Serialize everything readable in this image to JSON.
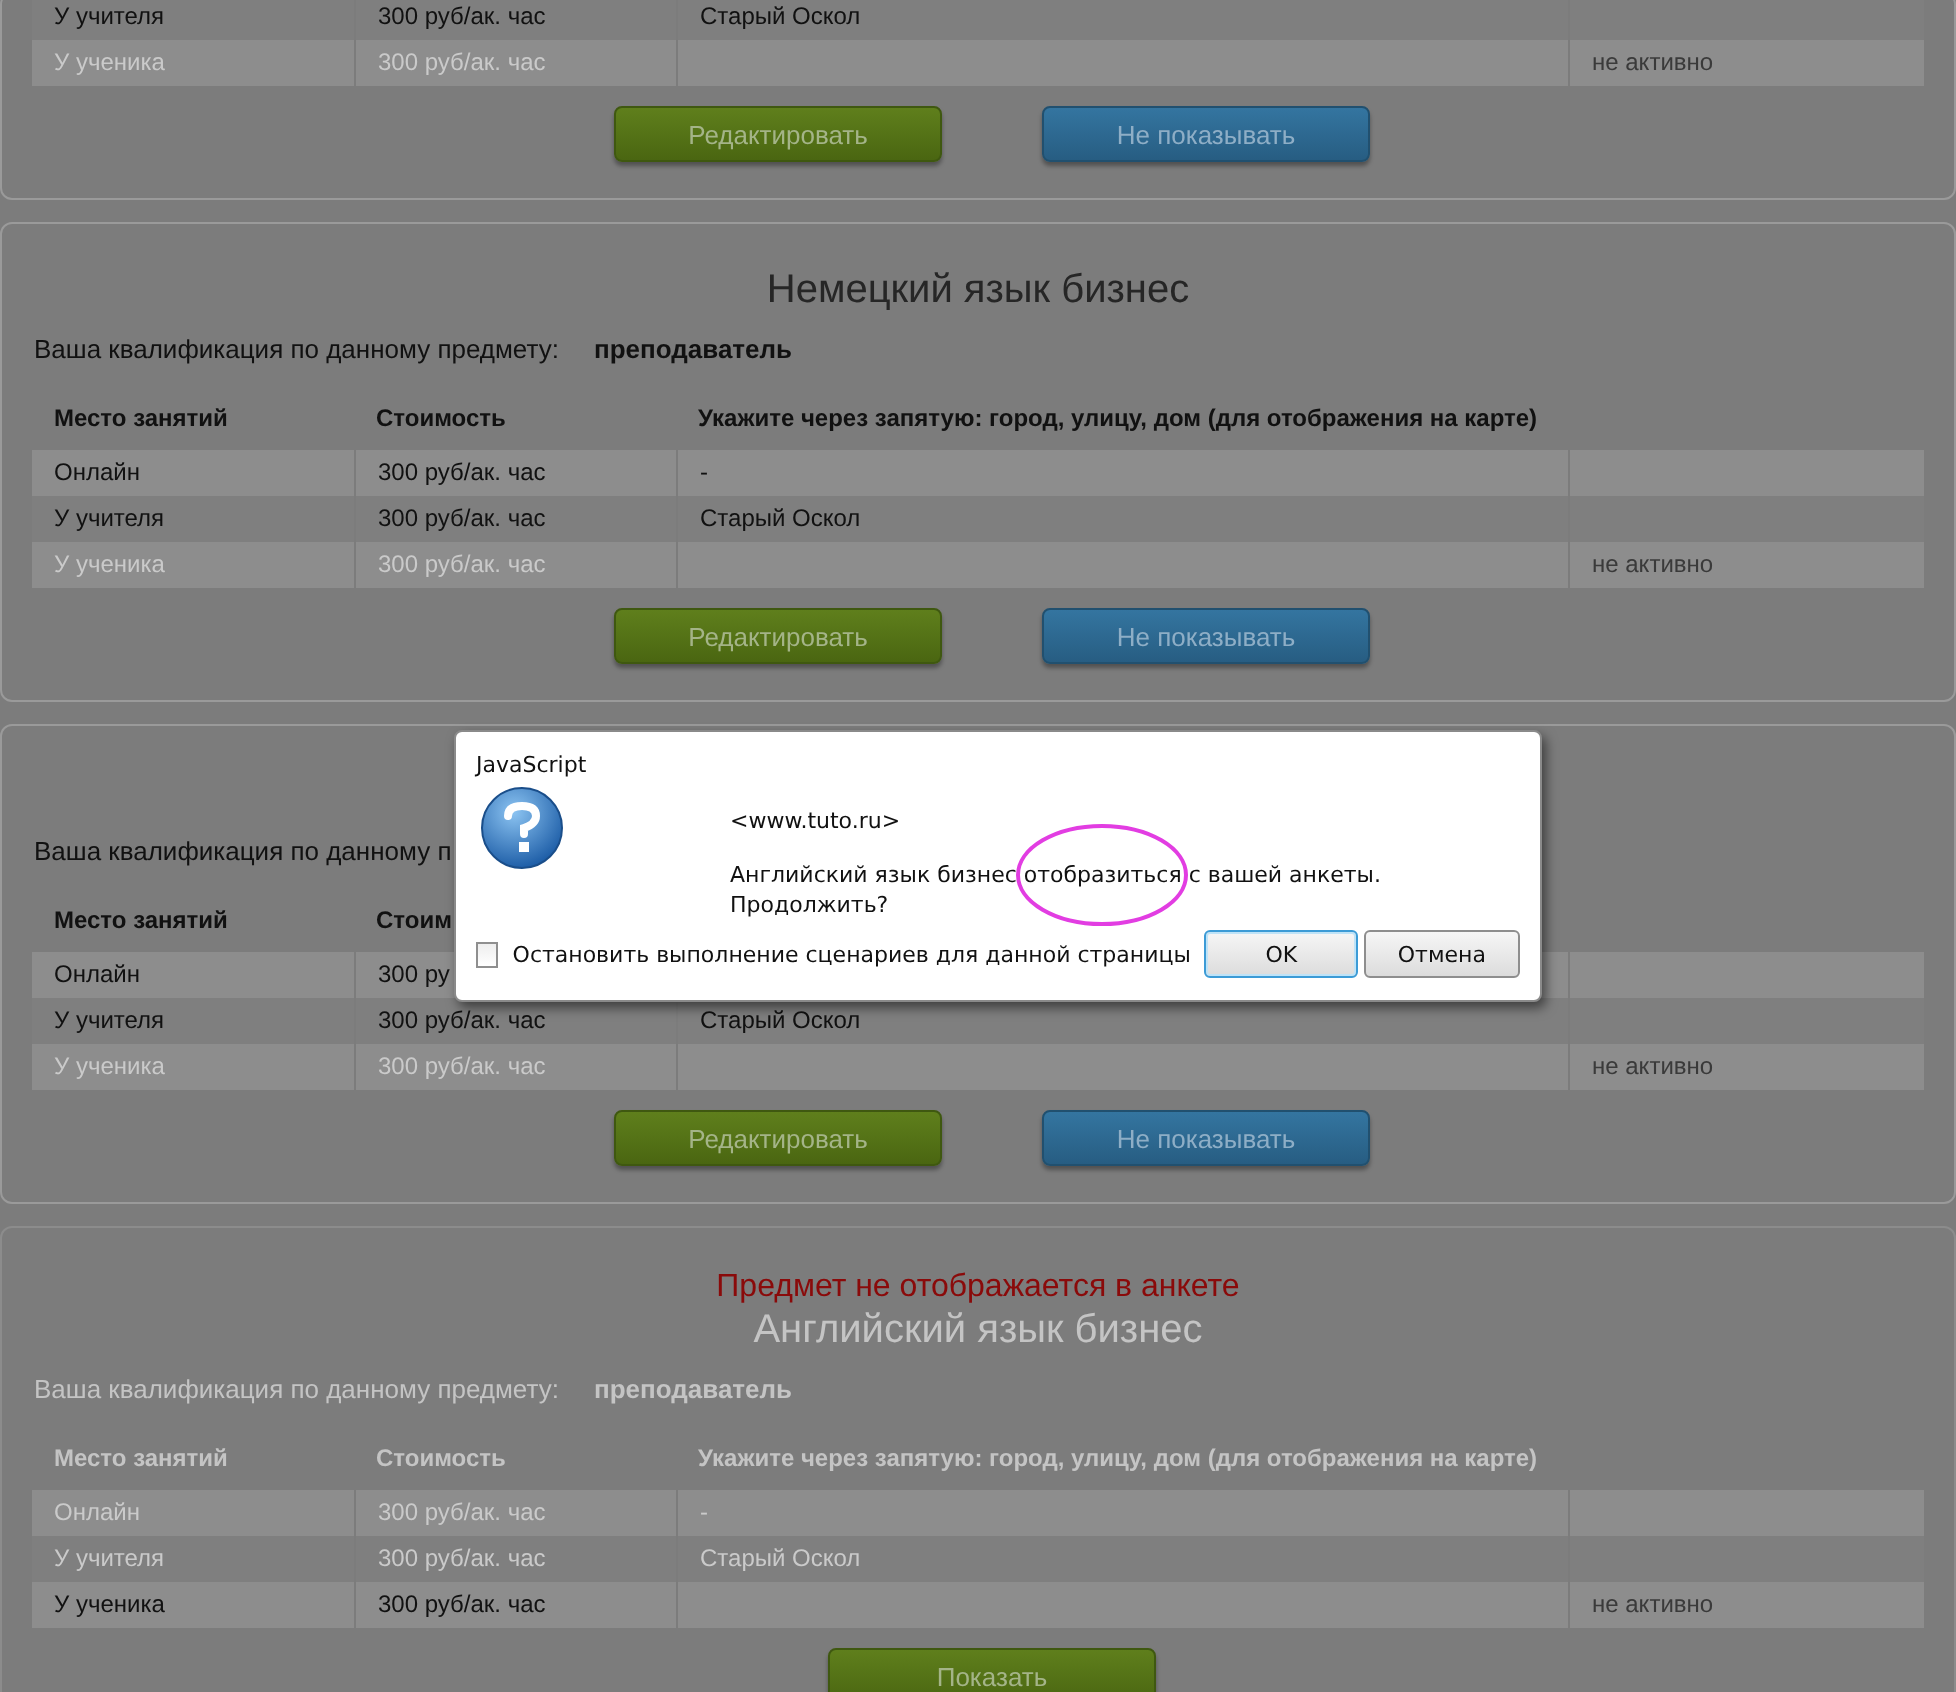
{
  "cards": [
    {
      "disabled": false,
      "rows": [
        {
          "place": "У учителя",
          "price": "300 руб/ак. час",
          "address": "Старый Оскол",
          "active": true,
          "striped": false
        },
        {
          "place": "У ученика",
          "price": "300 руб/ак. час",
          "status": "не активно",
          "active": false,
          "striped": true
        }
      ],
      "buttons": [
        {
          "label": "Редактировать",
          "kind": "edit"
        },
        {
          "label": "Не показывать",
          "kind": "hide"
        }
      ]
    },
    {
      "disabled": false,
      "title": "Немецкий язык бизнес",
      "qualification": {
        "label": "Ваша квалификация по данному предмету:",
        "value": "преподаватель"
      },
      "columns": [
        "Место занятий",
        "Стоимость",
        "Укажите через запятую: город, улицу, дом (для отображения на карте)"
      ],
      "rows": [
        {
          "place": "Онлайн",
          "price": "300 руб/ак. час",
          "address": "-",
          "active": true,
          "striped": true
        },
        {
          "place": "У учителя",
          "price": "300 руб/ак. час",
          "address": "Старый Оскол",
          "active": true,
          "striped": false
        },
        {
          "place": "У ученика",
          "price": "300 руб/ак. час",
          "status": "не активно",
          "active": false,
          "striped": true
        }
      ],
      "buttons": [
        {
          "label": "Редактировать",
          "kind": "edit"
        },
        {
          "label": "Не показывать",
          "kind": "hide"
        }
      ]
    },
    {
      "disabled": false,
      "qualification": {
        "label": "Ваша квалификация по данному п"
      },
      "columns": [
        "Место занятий",
        "Стоим"
      ],
      "rows": [
        {
          "place": "Онлайн",
          "price": "300 ру",
          "active": true,
          "striped": true
        },
        {
          "place": "У учителя",
          "price": "300 руб/ак. час",
          "address": "Старый Оскол",
          "active": true,
          "striped": false
        },
        {
          "place": "У ученика",
          "price": "300 руб/ак. час",
          "status": "не активно",
          "active": false,
          "striped": true
        }
      ],
      "buttons": [
        {
          "label": "Редактировать",
          "kind": "edit"
        },
        {
          "label": "Не показывать",
          "kind": "hide"
        }
      ]
    },
    {
      "disabled": true,
      "note": "Предмет не отображается в анкете",
      "title": "Английский язык бизнес",
      "qualification": {
        "label": "Ваша квалификация по данному предмету:",
        "value": "преподаватель"
      },
      "columns": [
        "Место занятий",
        "Стоимость",
        "Укажите через запятую: город, улицу, дом (для отображения на карте)"
      ],
      "rows": [
        {
          "place": "Онлайн",
          "price": "300 руб/ак. час",
          "address": "-",
          "active": false,
          "striped": true
        },
        {
          "place": "У учителя",
          "price": "300 руб/ак. час",
          "address": "Старый Оскол",
          "active": false,
          "striped": false
        },
        {
          "place": "У ученика",
          "price": "300 руб/ак. час",
          "status": "не активно",
          "active": true,
          "striped": true
        }
      ],
      "buttons": [
        {
          "label": "Показать",
          "kind": "edit"
        }
      ]
    }
  ],
  "dialog": {
    "title": "JavaScript",
    "source": "<www.tuto.ru>",
    "message": "Английский язык бизнес отобразиться с вашей анкеты.",
    "question": "Продолжить?",
    "checkbox": {
      "label": "Остановить выполнение сценариев для данной страницы",
      "checked": false
    },
    "buttons": [
      {
        "label": "OK",
        "focused": true
      },
      {
        "label": "Отмена",
        "focused": false
      }
    ]
  }
}
